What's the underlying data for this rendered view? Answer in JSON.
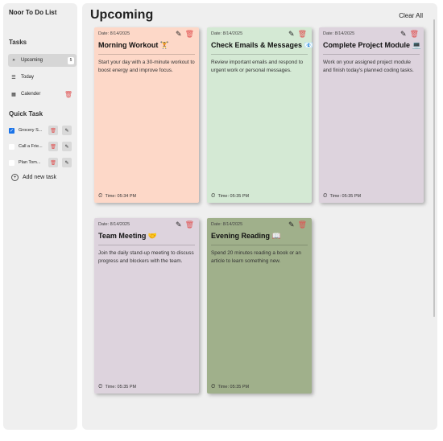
{
  "app": {
    "title": "Noor To Do List"
  },
  "sidebar": {
    "tasks_heading": "Tasks",
    "nav": [
      {
        "label": "Upcoming",
        "icon": "»",
        "icon_name": "double-chevron-icon",
        "count": "5",
        "active": true
      },
      {
        "label": "Today",
        "icon": "☰",
        "icon_name": "list-icon"
      },
      {
        "label": "Calender",
        "icon": "▦",
        "icon_name": "calendar-icon"
      }
    ],
    "quick_heading": "Quick Task",
    "quick_tasks": [
      {
        "label": "Grocery S...",
        "checked": true
      },
      {
        "label": "Call a Frie...",
        "checked": false
      },
      {
        "label": "Plan Tom...",
        "checked": false
      }
    ],
    "add_label": "Add new task"
  },
  "main": {
    "title": "Upcoming",
    "clear_label": "Clear All",
    "cards": [
      {
        "date": "Date: 8/14/2025",
        "title": "Morning Workout 🏋",
        "desc": "Start your day with a 30-minute workout to boost energy and improve focus.",
        "time": "Time: 05:34 PM",
        "color": "#fdd8c8"
      },
      {
        "date": "Date: 8/14/2025",
        "title": "Check Emails & Messages 📧",
        "desc": "Review important emails and respond to urgent work or personal messages.",
        "time": "Time: 05:35 PM",
        "color": "#d4e9d4"
      },
      {
        "date": "Date: 8/14/2025",
        "title": "Complete Project Module 💻",
        "desc": "Work on your assigned project module and finish today's planned coding tasks.",
        "time": "Time: 05:35 PM",
        "color": "#ddd3dd"
      },
      {
        "date": "Date: 8/14/2025",
        "title": "Team Meeting 🤝",
        "desc": "Join the daily stand-up meeting to discuss progress and blockers with the team.",
        "time": "Time: 05:35 PM",
        "color": "#ddd3dd"
      },
      {
        "date": "Date: 8/14/2025",
        "title": "Evening Reading 📖",
        "desc": "Spend 20 minutes reading a book or an article to learn something new.",
        "time": "Time: 05:35 PM",
        "color": "#a0b08b"
      }
    ]
  }
}
